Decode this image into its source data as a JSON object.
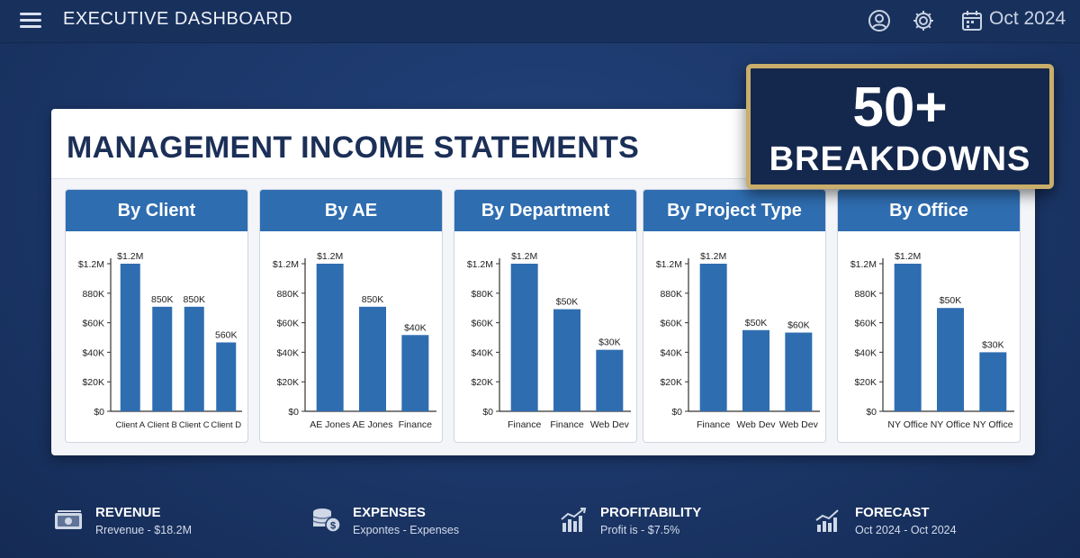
{
  "topbar": {
    "title": "EXECUTIVE DASHBOARD",
    "date": "Oct 2024",
    "icons": [
      "menu-icon",
      "user-icon",
      "gear-icon",
      "calendar-icon"
    ]
  },
  "panel": {
    "title": "MANAGEMENT INCOME STATEMENTS"
  },
  "badge": {
    "big": "50+",
    "small": "BREAKDOWNS",
    "border_color": "#c9ad6b"
  },
  "colors": {
    "bar": "#2f6db1",
    "header": "#2f6db1",
    "navy": "#1b2f57"
  },
  "chart_data": [
    {
      "type": "bar",
      "title": "By Client",
      "y_ticks": [
        "$1.2M",
        "880K",
        "$60K",
        "$40K",
        "$20K",
        "$0"
      ],
      "categories": [
        "Client A",
        "Client B",
        "Client C",
        "Client D"
      ],
      "values": [
        1.2,
        0.85,
        0.85,
        0.56
      ],
      "labels": [
        "$1.2M",
        "850K",
        "850K",
        "560K"
      ],
      "ylim": [
        0,
        1.2
      ]
    },
    {
      "type": "bar",
      "title": "By AE",
      "y_ticks": [
        "$1.2M",
        "880K",
        "$60K",
        "$40K",
        "$20K",
        "$0"
      ],
      "categories": [
        "AE Jones",
        "AE Jones",
        "Finance"
      ],
      "values": [
        1.2,
        0.85,
        0.62
      ],
      "labels": [
        "$1.2M",
        "850K",
        "$40K"
      ],
      "ylim": [
        0,
        1.2
      ]
    },
    {
      "type": "bar",
      "title": "By Department",
      "y_ticks": [
        "$1.2M",
        "$80K",
        "$60K",
        "$40K",
        "$20K",
        "$0"
      ],
      "categories": [
        "Finance",
        "Finance",
        "Web Dev"
      ],
      "values": [
        1.2,
        0.83,
        0.5
      ],
      "labels": [
        "$1.2M",
        "$50K",
        "$30K"
      ],
      "ylim": [
        0,
        1.2
      ]
    },
    {
      "type": "bar",
      "title": "By Project Type",
      "y_ticks": [
        "$1.2M",
        "880K",
        "$60K",
        "$40K",
        "$20K",
        "$0"
      ],
      "categories": [
        "Finance",
        "Web Dev",
        "Web Dev"
      ],
      "values": [
        1.2,
        0.66,
        0.64
      ],
      "labels": [
        "$1.2M",
        "$50K",
        "$60K"
      ],
      "ylim": [
        0,
        1.2
      ]
    },
    {
      "type": "bar",
      "title": "By Office",
      "y_ticks": [
        "$1.2M",
        "880K",
        "$60K",
        "$40K",
        "$20K",
        "$0"
      ],
      "categories": [
        "NY Office",
        "NY Office",
        "NY Office"
      ],
      "values": [
        1.2,
        0.84,
        0.48
      ],
      "labels": [
        "$1.2M",
        "$50K",
        "$30K"
      ],
      "ylim": [
        0,
        1.2
      ]
    }
  ],
  "kpis": [
    {
      "title": "REVENUE",
      "sub": "Rrevenue - $18.2M",
      "icon": "cash-icon"
    },
    {
      "title": "EXPENSES",
      "sub": "Expontes - Expenses",
      "icon": "coins-icon"
    },
    {
      "title": "PROFITABILITY",
      "sub": "Profit is - $7.5%",
      "icon": "bar-chart-icon"
    },
    {
      "title": "FORECAST",
      "sub": "Oct 2024 - Oct 2024",
      "icon": "trend-chart-icon"
    }
  ]
}
